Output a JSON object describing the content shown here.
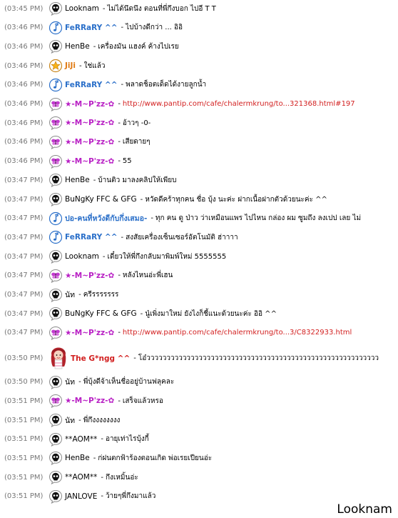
{
  "messages": [
    {
      "time": "(03:45 PM)",
      "icon": "skull-icon",
      "name": "Looknam",
      "color": "#000000",
      "bold": false,
      "text": "ไม่ได้นึดนึง ตอนที่พี่กึงบอก ไปอี T T"
    },
    {
      "time": "(03:46 PM)",
      "icon": "music-note-icon",
      "name": "FeRRaRY ^^",
      "color": "#2a6fc9",
      "bold": true,
      "text": "ไปบ้างดีกว่า ... อิอิ"
    },
    {
      "time": "(03:46 PM)",
      "icon": "skull-icon",
      "name": "HenBe",
      "color": "#000000",
      "bold": false,
      "text": "เครื่องมัน แฮงค์ ค้างไปเรย"
    },
    {
      "time": "(03:46 PM)",
      "icon": "star-icon",
      "name": "JiJi",
      "color": "#e07a12",
      "bold": true,
      "text": "ใช่แล้ว"
    },
    {
      "time": "(03:46 PM)",
      "icon": "music-note-icon",
      "name": "FeRRaRY ^^",
      "color": "#2a6fc9",
      "bold": true,
      "text": "พลาดช็อตเด็ดได้งายลูกน้ำ"
    },
    {
      "time": "(03:46 PM)",
      "icon": "butterfly-icon",
      "name": "★-M~P'zz-✿",
      "color": "#b81fc4",
      "bold": true,
      "text": "http://www.pantip.com/cafe/chalermkrung/to...321368.html#197",
      "link": true
    },
    {
      "time": "(03:46 PM)",
      "icon": "butterfly-icon",
      "name": "★-M~P'zz-✿",
      "color": "#b81fc4",
      "bold": true,
      "text": "อ้าวๆ -0-"
    },
    {
      "time": "(03:46 PM)",
      "icon": "butterfly-icon",
      "name": "★-M~P'zz-✿",
      "color": "#b81fc4",
      "bold": true,
      "text": "เสียดายๆ"
    },
    {
      "time": "(03:46 PM)",
      "icon": "butterfly-icon",
      "name": "★-M~P'zz-✿",
      "color": "#b81fc4",
      "bold": true,
      "text": "55"
    },
    {
      "time": "(03:47 PM)",
      "icon": "skull-icon",
      "name": "HenBe",
      "color": "#000000",
      "bold": false,
      "text": "บ้านติว มาลงคลิปให้เพียบ"
    },
    {
      "time": "(03:47 PM)",
      "icon": "skull-icon",
      "name": "BuNgKy FFC & GFG",
      "color": "#000000",
      "bold": false,
      "text": "หวัดดีคร้าทุกคน ชื่อ บุ้ง นะค่ะ ฝากเนื้อฝากตัวด้วยนะค่ะ ^^"
    },
    {
      "time": "(03:47 PM)",
      "icon": "music-note-icon",
      "name": "ปอ-คนที่หวังดีกับกึ่งเสมอ-",
      "color": "#2a6fc9",
      "bold": true,
      "text": "ทุก คน ดู ป่าว ว่าเหมือนแพร ไปไหน กล่อง ผม ซูมถึง ลงเปป เลย ไม่"
    },
    {
      "time": "(03:47 PM)",
      "icon": "music-note-icon",
      "name": "FeRRaRY ^^",
      "color": "#2a6fc9",
      "bold": true,
      "text": "สงสัยเครื่องเซ็นเซอร์อัตโนมัติ ฮ่าาาา"
    },
    {
      "time": "(03:47 PM)",
      "icon": "skull-icon",
      "name": "Looknam",
      "color": "#000000",
      "bold": false,
      "text": "เดี๋ยวให้พี่กึงกลับมาพิมพ์ใหม่ 5555555"
    },
    {
      "time": "(03:47 PM)",
      "icon": "butterfly-icon",
      "name": "★-M~P'zz-✿",
      "color": "#b81fc4",
      "bold": true,
      "text": "หลังไหนอ่ะพี่เฮน"
    },
    {
      "time": "(03:47 PM)",
      "icon": "skull-icon",
      "name": "นัท",
      "color": "#000000",
      "bold": false,
      "text": "ครีรรรรรรร"
    },
    {
      "time": "(03:47 PM)",
      "icon": "skull-icon",
      "name": "BuNgKy FFC & GFG",
      "color": "#000000",
      "bold": false,
      "text": "นู๋เพิ่งมาใหม่ ยังไงก็ชี้แนะด้วยนะค่ะ อิอิ ^^"
    },
    {
      "time": "(03:47 PM)",
      "icon": "butterfly-icon",
      "name": "★-M~P'zz-✿",
      "color": "#b81fc4",
      "bold": true,
      "text": "http://www.pantip.com/cafe/chalermkrung/to...3/C8322933.html",
      "link": true
    },
    {
      "time": "(03:50 PM)",
      "icon": "girl-avatar-icon",
      "name": "The G*ngg ^^",
      "color": "#d21f1f",
      "bold": true,
      "text": "โอ๋วววววววววววววววววววววววววววววววววววววววววววววววววววววววววว",
      "big": true
    },
    {
      "time": "(03:50 PM)",
      "icon": "skull-icon",
      "name": "นัท",
      "color": "#000000",
      "bold": false,
      "text": "พี่บุ้งดีจ้าเห็นชื่ออยู่บ้านฟลุคละ"
    },
    {
      "time": "(03:51 PM)",
      "icon": "butterfly-icon",
      "name": "★-M~P'zz-✿",
      "color": "#b81fc4",
      "bold": true,
      "text": "เสร็จแล้วหรอ"
    },
    {
      "time": "(03:51 PM)",
      "icon": "skull-icon",
      "name": "นัท",
      "color": "#000000",
      "bold": false,
      "text": "พี่กึงงงงงงงง"
    },
    {
      "time": "(03:51 PM)",
      "icon": "skull-icon",
      "name": "**AOM**",
      "color": "#000000",
      "bold": false,
      "text": "อายุเท่าไรบุ้งกี้"
    },
    {
      "time": "(03:51 PM)",
      "icon": "skull-icon",
      "name": "HenBe",
      "color": "#000000",
      "bold": false,
      "text": "ก่ฝนตกฟ้าร้องตอนเกิด พ่อเรยเปียนอ่ะ"
    },
    {
      "time": "(03:51 PM)",
      "icon": "skull-icon",
      "name": "**AOM**",
      "color": "#000000",
      "bold": false,
      "text": "กึงเหมิ้นอ่ะ"
    },
    {
      "time": "(03:51 PM)",
      "icon": "skull-icon",
      "name": "JANLOVE",
      "color": "#000000",
      "bold": false,
      "text": "ว้ายๆพี่กึงมาแล้ว"
    }
  ],
  "separator": "-",
  "footer": "Looknam"
}
